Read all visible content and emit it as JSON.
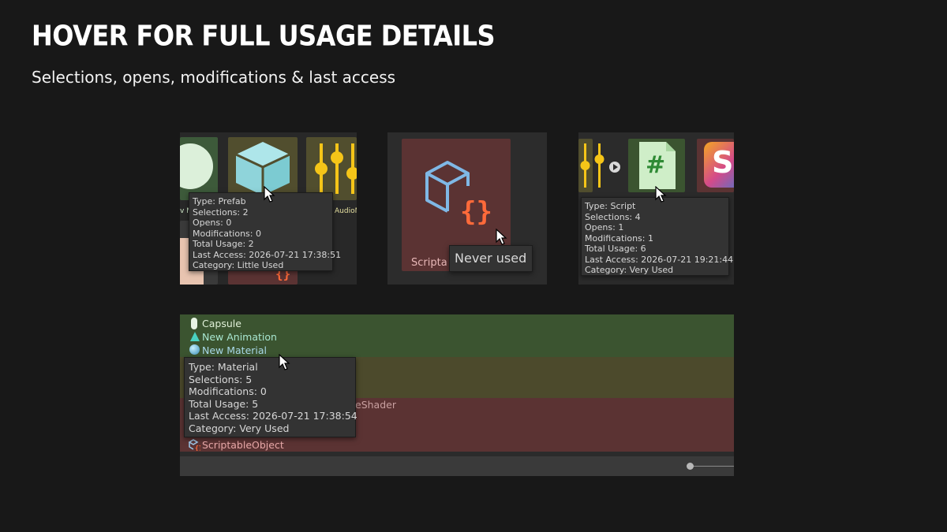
{
  "slide": {
    "title": "HOVER FOR FULL USAGE DETAILS",
    "subtitle": "Selections, opens, modifications & last access"
  },
  "panel_prefab": {
    "visible_label": "AudioM",
    "visible_label_left": "v M",
    "tooltip": [
      "Type: Prefab",
      "Selections: 2",
      "Opens: 0",
      "Modifications: 0",
      "Total Usage: 2",
      "Last Access: 2026-07-21 17:38:51",
      "Category: Little Used"
    ]
  },
  "panel_scriptable": {
    "tile_label": "Scripta",
    "tooltip": "Never used"
  },
  "panel_script": {
    "tile_glyph": "#",
    "tile_glyph_right": "S",
    "tooltip": [
      "Type: Script",
      "Selections: 4",
      "Opens: 1",
      "Modifications: 1",
      "Total Usage: 6",
      "Last Access: 2026-07-21 19:21:44",
      "Category: Very Used"
    ]
  },
  "panel_list": {
    "rows": [
      "Capsule",
      "New Animation",
      "New Material"
    ],
    "partial_row": "eShader",
    "last_row": "ScriptableObject",
    "tooltip": [
      "Type: Material",
      "Selections: 5",
      "Modifications: 0",
      "Total Usage: 5",
      "Last Access: 2026-07-21 17:38:54",
      "Category: Very Used"
    ]
  },
  "colors": {
    "very_used": "#3b5430",
    "little_used": "#4c4a2c",
    "never_used": "#5b3333",
    "accent_yellow": "#f5c518"
  }
}
